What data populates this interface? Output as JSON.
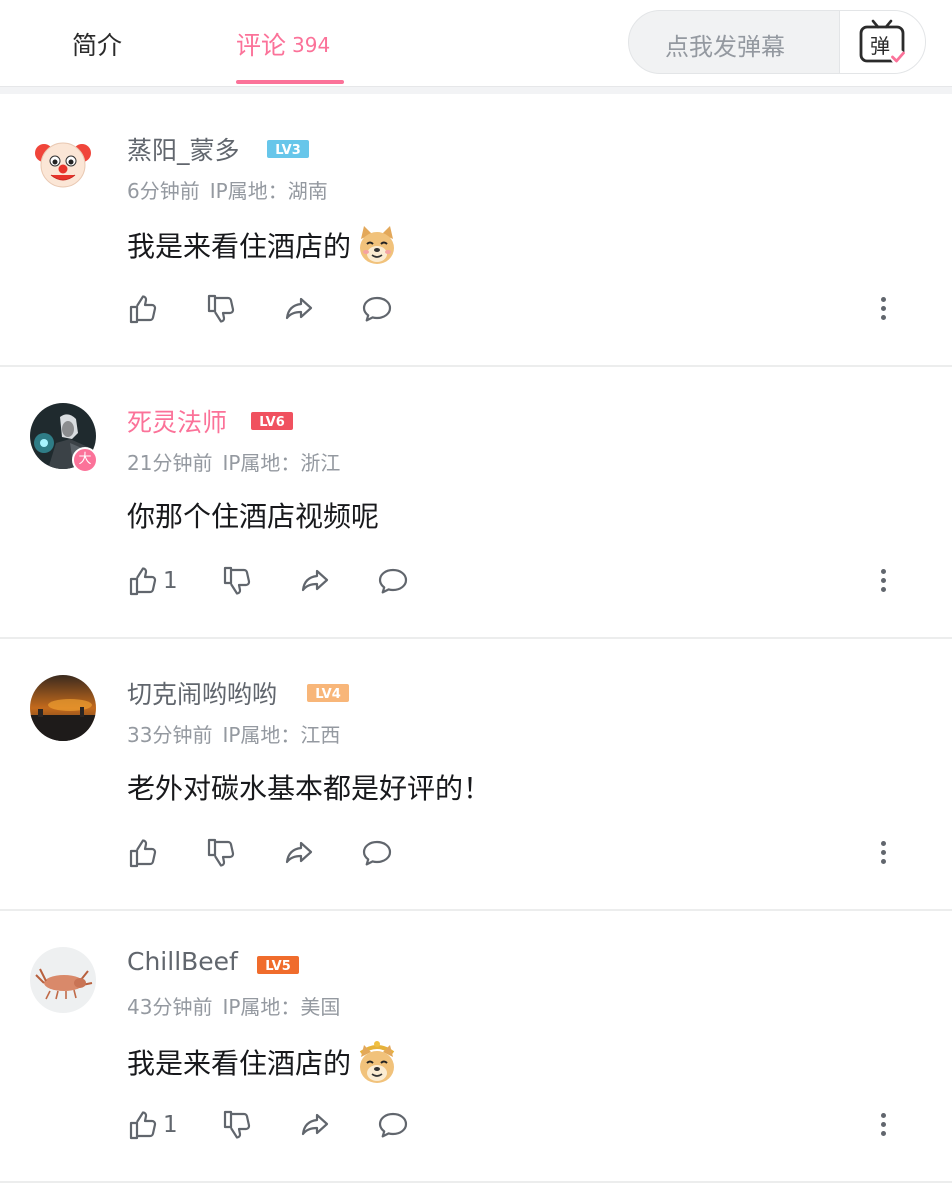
{
  "tabs": {
    "intro_label": "简介",
    "comments_label": "评论",
    "comments_count": "394",
    "active": "comments",
    "accent_color": "#fb7299"
  },
  "danmaku": {
    "placeholder": "点我发弹幕",
    "button_glyph": "弹",
    "button_icon": "danmaku-tv-icon"
  },
  "comments": [
    {
      "username": "蒸阳_蒙多",
      "username_color": "#61666d",
      "level": "LV3",
      "level_color": "#67c6ea",
      "time": "6分钟前",
      "ip": "IP属地：湖南",
      "text": "我是来看住酒店的",
      "emoji": "doge-emoji",
      "avatar": "clown-emoji-avatar",
      "likes": "",
      "badge": ""
    },
    {
      "username": "死灵法师",
      "username_color": "#fb7299",
      "level": "LV6",
      "level_color": "#f0515f",
      "time": "21分钟前",
      "ip": "IP属地：浙江",
      "text": "你那个住酒店视频呢",
      "emoji": "",
      "avatar": "dark-knight-avatar",
      "likes": "1",
      "badge": "大"
    },
    {
      "username": "切克闹哟哟哟",
      "username_color": "#61666d",
      "level": "LV4",
      "level_color": "#f8b679",
      "time": "33分钟前",
      "ip": "IP属地：江西",
      "text": "老外对碳水基本都是好评的！",
      "emoji": "",
      "avatar": "sunset-city-avatar",
      "likes": "",
      "badge": ""
    },
    {
      "username": "ChillBeef",
      "username_color": "#61666d",
      "level": "LV5",
      "level_color": "#f06c2c",
      "time": "43分钟前",
      "ip": "IP属地：美国",
      "text": "我是来看住酒店的",
      "emoji": "doge-monkey-king-emoji",
      "avatar": "lobster-avatar",
      "likes": "1",
      "badge": ""
    }
  ],
  "action_icons": [
    "thumb-up-icon",
    "thumb-down-icon",
    "share-icon",
    "reply-bubble-icon",
    "more-vertical-icon"
  ]
}
